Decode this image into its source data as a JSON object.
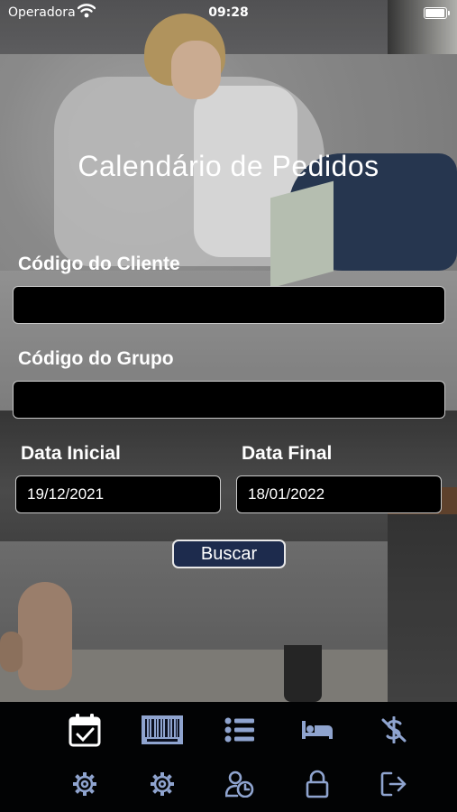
{
  "status_bar": {
    "carrier": "Operadora",
    "time": "09:28"
  },
  "screen": {
    "title": "Calendário de Pedidos"
  },
  "form": {
    "client_code_label": "Código do Cliente",
    "client_code_value": "",
    "group_code_label": "Código do Grupo",
    "group_code_value": "",
    "start_date_label": "Data Inicial",
    "start_date_value": "19/12/2021",
    "end_date_label": "Data Final",
    "end_date_value": "18/01/2022",
    "search_label": "Buscar"
  },
  "toolbar": {
    "row1": [
      "calendar-check-icon",
      "barcode-icon",
      "list-icon",
      "bed-icon",
      "dollar-off-icon"
    ],
    "row2": [
      "gear-sync-icon",
      "gear-sync-icon",
      "user-clock-icon",
      "lock-icon",
      "logout-icon"
    ],
    "active_index": 0
  },
  "colors": {
    "accent": "#8fa4cf",
    "active_icon": "#ffffff",
    "button_bg": "#1d2b4d",
    "toolbar_bg": "#020304"
  }
}
